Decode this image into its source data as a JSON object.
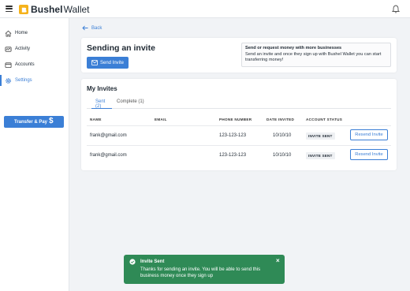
{
  "app": {
    "brand": "Bushel",
    "brand_suffix": "Wallet"
  },
  "icons": {
    "menu": "hamburger-icon",
    "logo": "bushel-logo-icon",
    "notifications": "bell-icon",
    "back": "arrow-left-icon",
    "send": "envelope-icon",
    "toast": "check-circle-icon",
    "close": "close-icon"
  },
  "colors": {
    "accent": "#3b7fd6",
    "logo": "#f5b21b",
    "toast": "#2f8a56"
  },
  "sidebar": {
    "items": [
      {
        "label": "Home",
        "icon": "home-icon",
        "active": false
      },
      {
        "label": "Activity",
        "icon": "activity-icon",
        "active": false
      },
      {
        "label": "Accounts",
        "icon": "accounts-icon",
        "active": false
      },
      {
        "label": "Settings",
        "icon": "gear-icon",
        "active": true
      }
    ],
    "transfer_label": "Transfer & Pay",
    "transfer_symbol": "$"
  },
  "back_label": "Back",
  "invite_card": {
    "title": "Sending an invite",
    "send_button": "Send Invite",
    "info_title": "Send or request money with more businesses",
    "info_text": "Send an invite and once they sign up with Bushel Wallet you can start transferring money!"
  },
  "invites": {
    "title": "My Invites",
    "tabs": [
      {
        "label": "Sent (2)"
      },
      {
        "label": "Complete (1)"
      }
    ],
    "columns": [
      "NAME",
      "EMAIL",
      "PHONE NUMBER",
      "DATE INVITED",
      "ACCOUNT STATUS"
    ],
    "rows": [
      {
        "name": "frank@gmail.com",
        "email": "",
        "phone": "123-123-123",
        "date": "10/10/10",
        "status": "INVITE SENT",
        "action": "Resend Invite"
      },
      {
        "name": "frank@gmail.com",
        "email": "",
        "phone": "123-123-123",
        "date": "10/10/10",
        "status": "INVITE SENT",
        "action": "Resend Invite"
      }
    ]
  },
  "toast": {
    "title": "Invite Sent",
    "message": "Thanks for sending an invite. You will be able to send this business money once they sign up",
    "close": "×"
  }
}
